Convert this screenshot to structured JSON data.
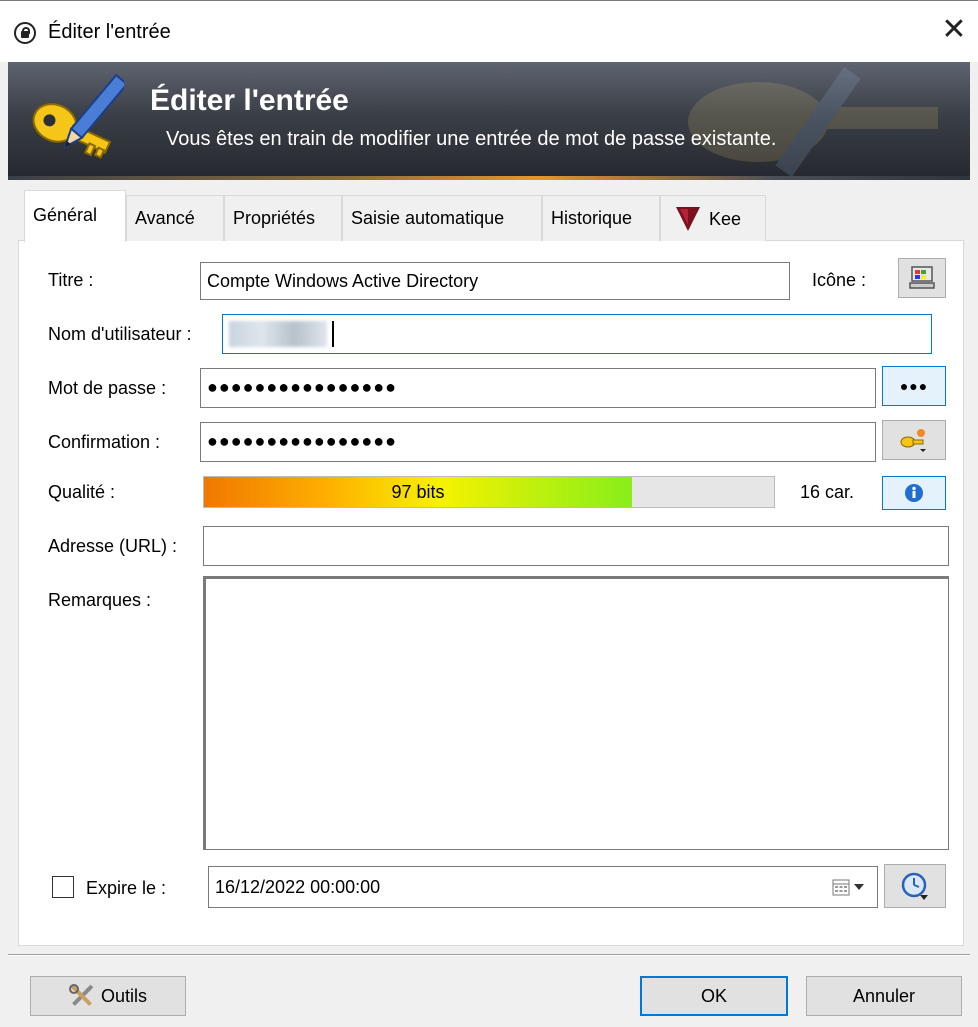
{
  "window": {
    "title": "Éditer l'entrée",
    "close_symbol": "✕"
  },
  "banner": {
    "title": "Éditer l'entrée",
    "subtitle": "Vous êtes en train de modifier une entrée de mot de passe existante."
  },
  "tabs": [
    {
      "label": "Général",
      "active": true
    },
    {
      "label": "Avancé",
      "active": false
    },
    {
      "label": "Propriétés",
      "active": false
    },
    {
      "label": "Saisie automatique",
      "active": false
    },
    {
      "label": "Historique",
      "active": false
    },
    {
      "label": "Kee",
      "active": false,
      "icon": "kee-icon"
    }
  ],
  "form": {
    "title_label": "Titre :",
    "title_value": "Compte Windows Active Directory",
    "icon_label": "Icône :",
    "username_label": "Nom d'utilisateur :",
    "password_label": "Mot de passe :",
    "password_value": "●●●●●●●●●●●●●●●●",
    "confirm_label": "Confirmation :",
    "confirm_value": "●●●●●●●●●●●●●●●●",
    "show_password_label": "●●●",
    "quality_label": "Qualité :",
    "quality_text": "97 bits",
    "quality_fraction": 0.75,
    "char_count": "16 car.",
    "url_label": "Adresse (URL) :",
    "url_value": "",
    "notes_label": "Remarques :",
    "notes_value": "",
    "expires_label": "Expire le :",
    "expires_checked": false,
    "expires_value": "16/12/2022 00:00:00"
  },
  "buttons": {
    "tools": "Outils",
    "ok": "OK",
    "cancel": "Annuler"
  },
  "colors": {
    "accent": "#0078d7",
    "banner_dark": "#2b2e34",
    "banner_stripe": "#e7952a"
  }
}
